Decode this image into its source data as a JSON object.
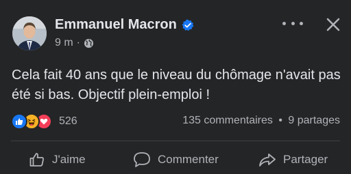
{
  "post": {
    "author": "Emmanuel Macron",
    "time": "9 m",
    "separator": "·",
    "text": "Cela fait 40 ans que le niveau du chômage n'avait pas été si bas. Objectif plein-emploi !",
    "reaction_count": "526",
    "comments": "135 commentaires",
    "stats_separator": "•",
    "shares": "9 partages",
    "reactions": [
      "like-icon",
      "haha-icon",
      "love-icon"
    ]
  },
  "actions": {
    "like": "J'aime",
    "comment": "Commenter",
    "share": "Partager"
  },
  "colors": {
    "background": "#242526",
    "text": "#e4e6eb",
    "secondary": "#b0b3b8",
    "verified": "#1877f2",
    "like": "#1877f2",
    "love": "#f33e58",
    "haha": "#f7b125"
  }
}
